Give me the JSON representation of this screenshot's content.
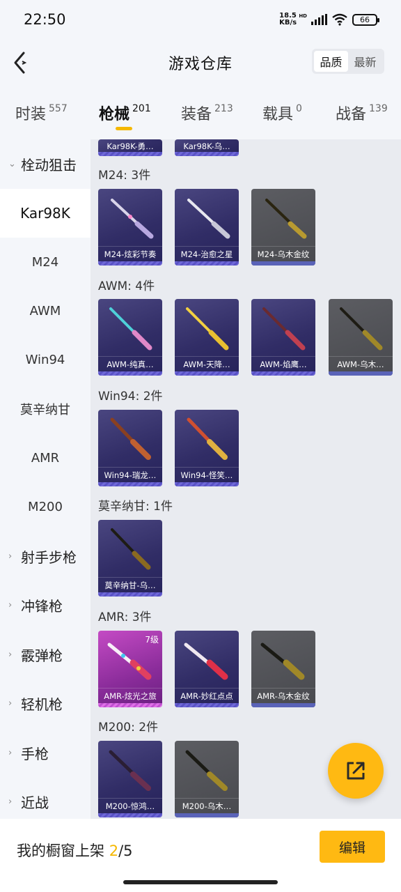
{
  "status": {
    "time": "22:50",
    "speed_top": "18.5",
    "speed_bottom": "KB/s",
    "hd": "HD",
    "battery": "66"
  },
  "header": {
    "title": "游戏仓库",
    "sort_quality": "品质",
    "sort_newest": "最新"
  },
  "tabs": [
    {
      "label": "时装",
      "count": "557"
    },
    {
      "label": "枪械",
      "count": "201"
    },
    {
      "label": "装备",
      "count": "213"
    },
    {
      "label": "载具",
      "count": "0"
    },
    {
      "label": "战备",
      "count": "139"
    }
  ],
  "sidebar": {
    "category_open": "栓动狙击",
    "items": [
      "Kar98K",
      "M24",
      "AWM",
      "Win94",
      "莫辛纳甘",
      "AMR",
      "M200"
    ],
    "categories": [
      "射手步枪",
      "冲锋枪",
      "霰弹枪",
      "轻机枪",
      "手枪",
      "近战"
    ]
  },
  "sections": [
    {
      "title": "",
      "cards": [
        {
          "label": "Kar98K-勇…",
          "style": "purple"
        },
        {
          "label": "Kar98K-乌…",
          "style": "purple"
        }
      ]
    },
    {
      "title": "M24: 3件",
      "cards": [
        {
          "label": "M24-炫彩节奏",
          "style": "purple"
        },
        {
          "label": "M24-治愈之星",
          "style": "purple"
        },
        {
          "label": "M24-乌木金纹",
          "style": "gray"
        }
      ]
    },
    {
      "title": "AWM: 4件",
      "cards": [
        {
          "label": "AWM-纯真…",
          "style": "purple"
        },
        {
          "label": "AWM-天降…",
          "style": "purple"
        },
        {
          "label": "AWM-焰鹰…",
          "style": "purple"
        },
        {
          "label": "AWM-乌木…",
          "style": "gray"
        }
      ]
    },
    {
      "title": "Win94: 2件",
      "cards": [
        {
          "label": "Win94-瑞龙…",
          "style": "purple"
        },
        {
          "label": "Win94-怪笑…",
          "style": "purple"
        }
      ]
    },
    {
      "title": "莫辛纳甘: 1件",
      "cards": [
        {
          "label": "莫辛纳甘-乌…",
          "style": "purple"
        }
      ]
    },
    {
      "title": "AMR: 3件",
      "cards": [
        {
          "label": "AMR-炫光之旅",
          "style": "pink",
          "level": "7级"
        },
        {
          "label": "AMR-妙红点点",
          "style": "purple"
        },
        {
          "label": "AMR-乌木金纹",
          "style": "gray"
        }
      ]
    },
    {
      "title": "M200: 2件",
      "cards": [
        {
          "label": "M200-惊鸿…",
          "style": "purple"
        },
        {
          "label": "M200-乌木…",
          "style": "gray"
        }
      ]
    }
  ],
  "bottom": {
    "text": "我的橱窗上架 ",
    "current": "2",
    "total": "/5",
    "edit": "编辑"
  },
  "colors": {
    "accent": "#ffb912",
    "card_purple": "#312d66",
    "card_gray": "#48494e",
    "card_pink": "#8a2c9a"
  }
}
